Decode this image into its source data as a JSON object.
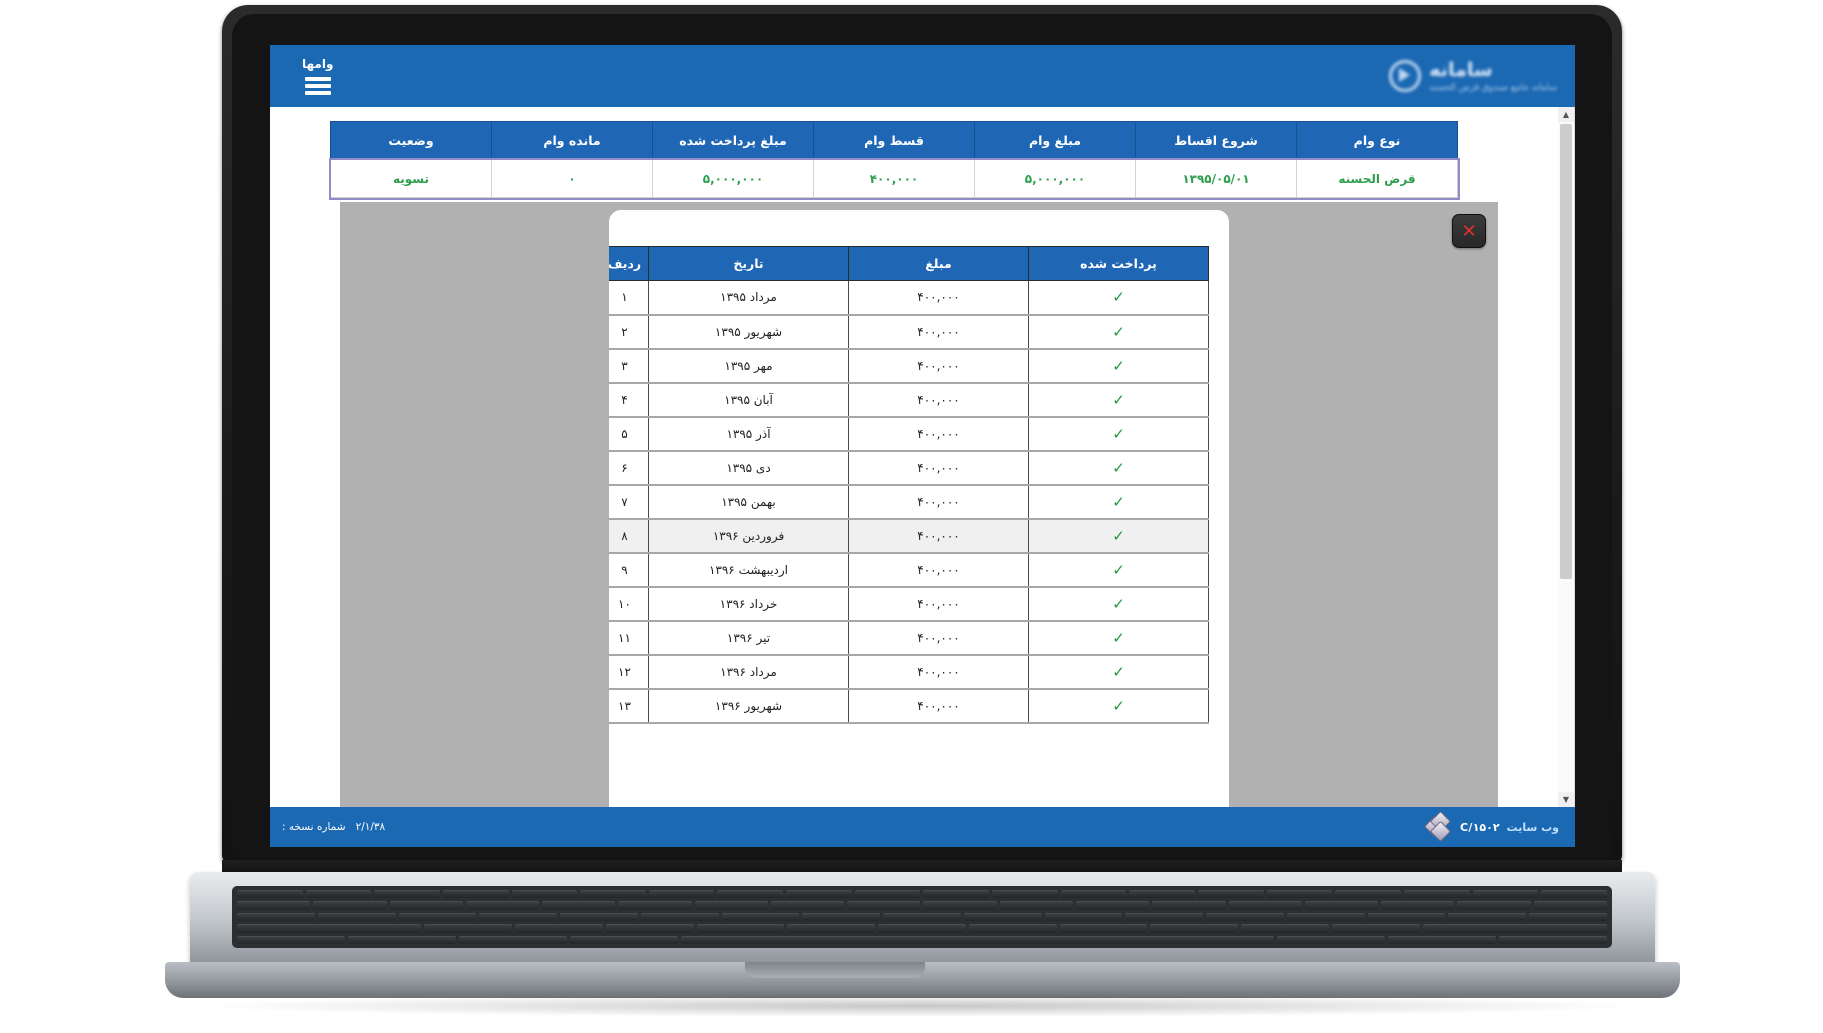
{
  "app": {
    "brand_title": "سامانه",
    "brand_subtitle": "سامانه جامع صندوق قرض الحسنه",
    "nav_loans": "وامها",
    "menu_icon": "hamburger-icon"
  },
  "summary_table": {
    "headers": [
      "نوع وام",
      "شروع اقساط",
      "مبلغ وام",
      "قسط وام",
      "مبلغ پرداخت شده",
      "مانده وام",
      "وضعیت"
    ],
    "rows": [
      {
        "loan_type": "قرض الحسنه",
        "start_date": "۱۳۹۵/۰۵/۰۱",
        "loan_amount": "۵,۰۰۰,۰۰۰",
        "installment": "۴۰۰,۰۰۰",
        "paid_amount": "۵,۰۰۰,۰۰۰",
        "remaining": "۰",
        "status": "تسویه"
      }
    ]
  },
  "modal": {
    "close_label": "✕",
    "headers": [
      "ردیف",
      "تاریخ",
      "مبلغ",
      "پرداخت شده"
    ],
    "paid_mark": "✓",
    "rows": [
      {
        "no": "۱",
        "date": "مرداد ۱۳۹۵",
        "amount": "۴۰۰,۰۰۰",
        "paid": "✓",
        "highlight": false
      },
      {
        "no": "۲",
        "date": "شهریور ۱۳۹۵",
        "amount": "۴۰۰,۰۰۰",
        "paid": "✓",
        "highlight": false
      },
      {
        "no": "۳",
        "date": "مهر ۱۳۹۵",
        "amount": "۴۰۰,۰۰۰",
        "paid": "✓",
        "highlight": false
      },
      {
        "no": "۴",
        "date": "آبان ۱۳۹۵",
        "amount": "۴۰۰,۰۰۰",
        "paid": "✓",
        "highlight": false
      },
      {
        "no": "۵",
        "date": "آذر ۱۳۹۵",
        "amount": "۴۰۰,۰۰۰",
        "paid": "✓",
        "highlight": false
      },
      {
        "no": "۶",
        "date": "دی ۱۳۹۵",
        "amount": "۴۰۰,۰۰۰",
        "paid": "✓",
        "highlight": false
      },
      {
        "no": "۷",
        "date": "بهمن ۱۳۹۵",
        "amount": "۴۰۰,۰۰۰",
        "paid": "✓",
        "highlight": false
      },
      {
        "no": "۸",
        "date": "فروردین ۱۳۹۶",
        "amount": "۴۰۰,۰۰۰",
        "paid": "✓",
        "highlight": true
      },
      {
        "no": "۹",
        "date": "اردیبهشت ۱۳۹۶",
        "amount": "۴۰۰,۰۰۰",
        "paid": "✓",
        "highlight": false
      },
      {
        "no": "۱۰",
        "date": "خرداد ۱۳۹۶",
        "amount": "۴۰۰,۰۰۰",
        "paid": "✓",
        "highlight": false
      },
      {
        "no": "۱۱",
        "date": "تیر ۱۳۹۶",
        "amount": "۴۰۰,۰۰۰",
        "paid": "✓",
        "highlight": false
      },
      {
        "no": "۱۲",
        "date": "مرداد ۱۳۹۶",
        "amount": "۴۰۰,۰۰۰",
        "paid": "✓",
        "highlight": false
      },
      {
        "no": "۱۳",
        "date": "شهریور ۱۳۹۶",
        "amount": "۴۰۰,۰۰۰",
        "paid": "✓",
        "highlight": false
      }
    ]
  },
  "footer": {
    "version_label": "شماره نسخه :",
    "version_value": "۲/۱/۳۸",
    "brand_code": "C/۱۵۰۲",
    "brand_text": "وب سایت"
  },
  "colors": {
    "primary_blue": "#1b68b3",
    "table_header_blue": "#1f67b5",
    "value_green": "#2f9e4f",
    "check_green": "#1f9a3a",
    "close_red": "#e03030",
    "overlay_gray": "#b1b1b1"
  }
}
